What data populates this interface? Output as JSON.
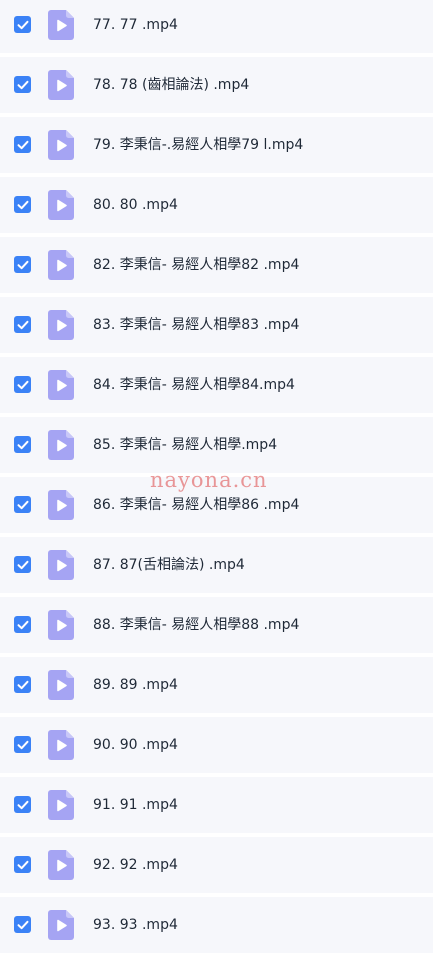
{
  "files": [
    {
      "name": "77. 77 .mp4",
      "checked": true,
      "icon": "video-file-icon"
    },
    {
      "name": "78. 78 (齒相論法) .mp4",
      "checked": true,
      "icon": "video-file-icon"
    },
    {
      "name": "79. 李秉信-.易經人相學79 l.mp4",
      "checked": true,
      "icon": "video-file-icon"
    },
    {
      "name": "80. 80 .mp4",
      "checked": true,
      "icon": "video-file-icon"
    },
    {
      "name": "82. 李秉信- 易經人相學82 .mp4",
      "checked": true,
      "icon": "video-file-icon"
    },
    {
      "name": "83. 李秉信- 易經人相學83 .mp4",
      "checked": true,
      "icon": "video-file-icon"
    },
    {
      "name": "84. 李秉信- 易經人相學84.mp4",
      "checked": true,
      "icon": "video-file-icon"
    },
    {
      "name": "85. 李秉信- 易經人相學.mp4",
      "checked": true,
      "icon": "video-file-icon"
    },
    {
      "name": "86. 李秉信- 易經人相學86 .mp4",
      "checked": true,
      "icon": "video-file-icon"
    },
    {
      "name": "87. 87(舌相論法) .mp4",
      "checked": true,
      "icon": "video-file-icon"
    },
    {
      "name": "88. 李秉信- 易經人相學88 .mp4",
      "checked": true,
      "icon": "video-file-icon"
    },
    {
      "name": "89. 89 .mp4",
      "checked": true,
      "icon": "video-file-icon"
    },
    {
      "name": "90. 90 .mp4",
      "checked": true,
      "icon": "video-file-icon"
    },
    {
      "name": "91. 91 .mp4",
      "checked": true,
      "icon": "video-file-icon"
    },
    {
      "name": "92. 92 .mp4",
      "checked": true,
      "icon": "video-file-icon"
    },
    {
      "name": "93. 93 .mp4",
      "checked": true,
      "icon": "video-file-icon"
    }
  ],
  "watermark": "nayona.cn",
  "colors": {
    "row_background": "#f6f7fb",
    "checkbox": "#3b82f6",
    "file_icon": "#a5a4f3",
    "file_icon_fold": "#c8c7f8",
    "text": "#1f2937",
    "watermark": "#dc4646"
  }
}
